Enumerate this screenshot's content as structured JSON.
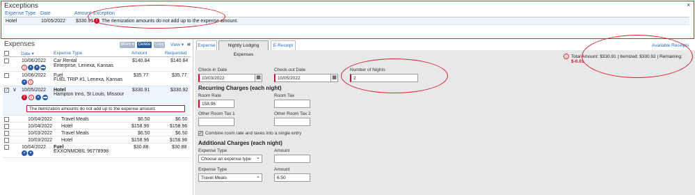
{
  "exceptions": {
    "title": "Exceptions",
    "headers": [
      "Expense Type",
      "Date",
      "Amount",
      "Exception"
    ],
    "row": {
      "type": "Hotel",
      "date": "10/05/2022",
      "amount": "$330.91",
      "message": "The itemization amounts do not add up to the expense amount."
    },
    "close": "×"
  },
  "expenses": {
    "title": "Expenses",
    "move_label": "Move ▾",
    "delete_label": "Delete",
    "copy_label": "Copy",
    "view_label": "View ▾",
    "collapse": "«",
    "headers": {
      "date": "Date ▾",
      "type": "Expense Type",
      "amount": "Amount",
      "requested": "Requested"
    },
    "items": [
      {
        "date": "10/06/2022",
        "type": "Car Rental",
        "sub": "Enterprise, Lenexa, Kansas",
        "amount": "$140.84",
        "requested": "$140.84"
      },
      {
        "date": "10/06/2022",
        "type": "Fuel",
        "sub": "FUEL TRIP #1, Lenexa, Kansas",
        "amount": "$35.77",
        "requested": "$35.77"
      },
      {
        "date": "10/05/2022",
        "type": "Hotel",
        "sub": "Hampton Inns, St Louis, Missour",
        "amount": "$330.91",
        "requested": "$330.92"
      },
      {
        "date": "10/04/2022",
        "type": "Travel Meals",
        "sub": "",
        "amount": "$6.50",
        "requested": "$6.50"
      },
      {
        "date": "10/04/2022",
        "type": "Hotel",
        "sub": "",
        "amount": "$158.96",
        "requested": "$158.96"
      },
      {
        "date": "10/03/2022",
        "type": "Travel Meals",
        "sub": "",
        "amount": "$6.50",
        "requested": "$6.50"
      },
      {
        "date": "10/03/2022",
        "type": "Hotel",
        "sub": "",
        "amount": "$158.96",
        "requested": "$158.96"
      },
      {
        "date": "10/04/2022",
        "type": "Fuel",
        "sub": "EXXONMOBIL 96778998",
        "amount": "$30.88",
        "requested": "$30.88"
      }
    ],
    "hotel_error": "The itemization amounts do not add up to the expense amount."
  },
  "tabs": [
    "Expense",
    "Nightly Lodging Expenses",
    "E-Receipt"
  ],
  "available_receipts": "Available Receipts",
  "totals": {
    "label": "Total Amount: $330.91 | Itemized: $330.92 | Remaining: ",
    "remaining": "$-0.01"
  },
  "form": {
    "checkin_label": "Check-in Date",
    "checkin_value": "10/03/2022",
    "checkout_label": "Check-out Date",
    "checkout_value": "10/05/2022",
    "nights_label": "Number of Nights",
    "nights_value": "2",
    "recurring_title": "Recurring Charges (each night)",
    "room_rate_label": "Room Rate",
    "room_rate_value": "158.96",
    "room_tax_label": "Room Tax",
    "other_tax1_label": "Other Room Tax 1",
    "other_tax2_label": "Other Room Tax 2",
    "combine_label": "Combine room rate and taxes into a single entry",
    "additional_title": "Additional Charges (each night)",
    "exp_type_label": "Expense Type",
    "exp_type_placeholder": "Choose an expense type",
    "amount_label": "Amount",
    "exp_type2_label": "Expense Type",
    "exp_type2_value": "Travel Meals",
    "amount2_label": "Amount",
    "amount2_value": "6.50"
  }
}
